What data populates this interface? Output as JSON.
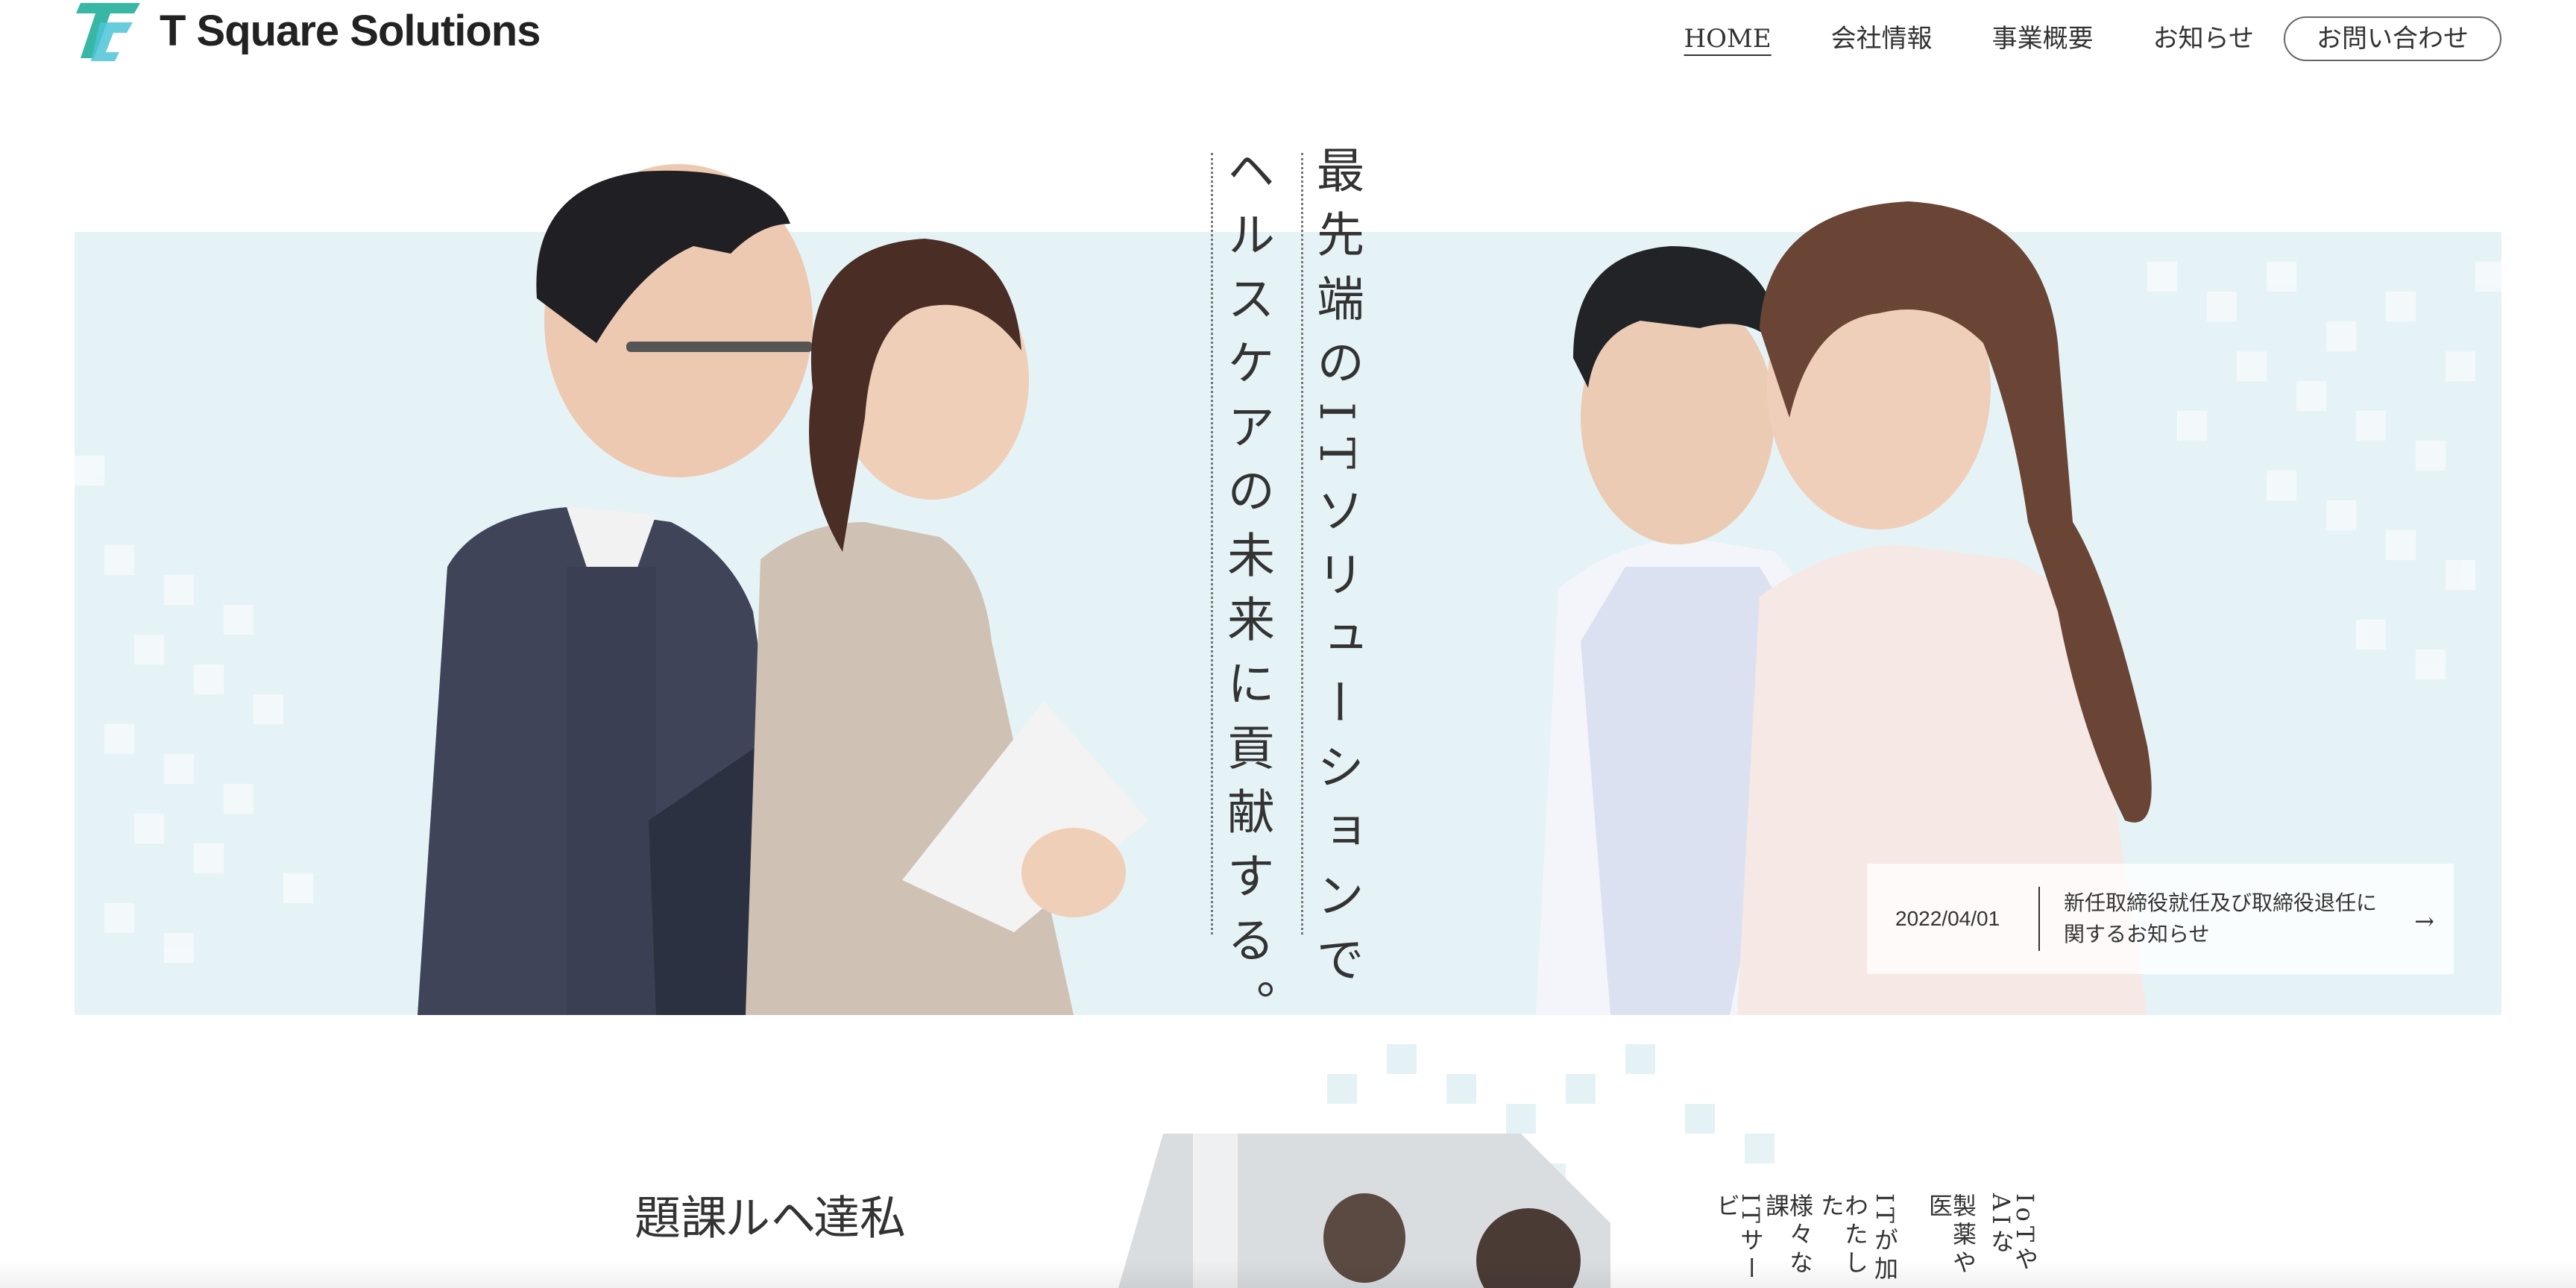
{
  "brand": {
    "name": "T Square Solutions",
    "logo_icon": "ts-logo-icon",
    "colors": {
      "teal": "#38b7a5",
      "cyan": "#4cc3d6",
      "hero_bg": "#e6f3f6"
    }
  },
  "nav": {
    "items": [
      {
        "label": "HOME",
        "active": true
      },
      {
        "label": "会社情報"
      },
      {
        "label": "事業概要"
      },
      {
        "label": "お知らせ"
      }
    ],
    "contact_label": "お問い合わせ"
  },
  "hero": {
    "catch_line_1": "最先端のITソリューションで",
    "catch_line_2": "ヘルスケアの未来に貢献する。"
  },
  "news": {
    "date": "2022/04/01",
    "title": "新任取締役就任及び取締役退任に関するお知らせ",
    "arrow_icon": "arrow-right-icon",
    "arrow_glyph": "→"
  },
  "section2": {
    "heading_cols": [
      "私達",
      "ヘル",
      "課題"
    ],
    "body_cols": [
      "IoTやAIな",
      "製薬や医",
      "ITが加",
      "わたした",
      "様々な課",
      "ITサービ"
    ]
  }
}
